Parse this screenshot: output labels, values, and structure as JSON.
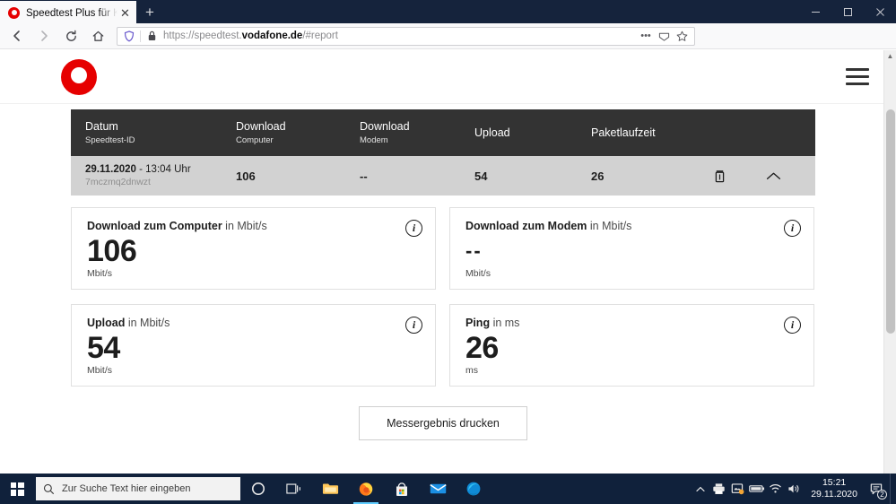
{
  "browser": {
    "tab": {
      "title": "Speedtest Plus für Kabel- und D",
      "close_label": "✕",
      "favicon": "vodafone-favicon"
    },
    "newtab_label": "+",
    "window_controls": {
      "minimize": "minimize-icon",
      "maximize": "restore-icon",
      "close": "close-icon"
    },
    "nav": {
      "back": "back-arrow-icon",
      "forward": "forward-arrow-icon",
      "reload": "reload-icon",
      "home": "home-icon"
    },
    "url": {
      "protocol": "https://speedtest.",
      "domain": "vodafone.de",
      "path": "/#report",
      "shield_icon": "tracking-protection-shield-icon",
      "lock_icon": "padlock-icon",
      "ellipsis": "page-actions-ellipsis-icon",
      "reader": "reader-view-icon",
      "bookmark": "bookmark-star-icon"
    },
    "toolbar": {
      "library": "library-icon",
      "sidebar": "sidebar-icon",
      "account": "account-icon",
      "menu": "hamburger-menu-icon"
    }
  },
  "page": {
    "logo": "vodafone-logo",
    "menu": "page-hamburger-menu",
    "table": {
      "headers": [
        {
          "title": "Datum",
          "sub": "Speedtest-ID"
        },
        {
          "title": "Download",
          "sub": "Computer"
        },
        {
          "title": "Download",
          "sub": "Modem"
        },
        {
          "title": "Upload",
          "sub": ""
        },
        {
          "title": "Paketlaufzeit",
          "sub": ""
        }
      ],
      "row": {
        "date": "29.11.2020",
        "date_sep": " - ",
        "time": "13:04 Uhr",
        "speedtest_id": "7mczmq2dnwzt",
        "download_computer": "106",
        "download_modem": "--",
        "upload": "54",
        "paketlaufzeit": "26",
        "delete_icon": "trash-icon",
        "collapse_icon": "chevron-up-icon"
      }
    },
    "cards": [
      {
        "name_bold": "Download zum Computer",
        "name_rest": " in Mbit/s",
        "value": "106",
        "unit": "Mbit/s",
        "info": "info-icon",
        "is_dash": false
      },
      {
        "name_bold": "Download zum Modem",
        "name_rest": " in Mbit/s",
        "value": "--",
        "unit": "Mbit/s",
        "info": "info-icon",
        "is_dash": true
      },
      {
        "name_bold": "Upload",
        "name_rest": " in Mbit/s",
        "value": "54",
        "unit": "Mbit/s",
        "info": "info-icon",
        "is_dash": false
      },
      {
        "name_bold": "Ping",
        "name_rest": " in ms",
        "value": "26",
        "unit": "ms",
        "info": "info-icon",
        "is_dash": false
      }
    ],
    "print_button": "Messergebnis drucken",
    "scrollbar": {
      "up": "▲",
      "down": "▼"
    }
  },
  "taskbar": {
    "start": "windows-start-icon",
    "search_placeholder": "Zur Suche Text hier eingeben",
    "search_icon": "search-magnifier-icon",
    "items": [
      {
        "name": "cortana-icon"
      },
      {
        "name": "task-view-icon"
      },
      {
        "name": "file-explorer-icon"
      },
      {
        "name": "firefox-icon"
      },
      {
        "name": "microsoft-store-icon"
      },
      {
        "name": "mail-icon"
      },
      {
        "name": "edge-icon"
      }
    ],
    "tray": [
      {
        "name": "tray-chevron-up-icon"
      },
      {
        "name": "printer-icon"
      },
      {
        "name": "onedrive-icon"
      },
      {
        "name": "battery-icon"
      },
      {
        "name": "wifi-icon"
      },
      {
        "name": "volume-icon"
      }
    ],
    "clock_time": "15:21",
    "clock_date": "29.11.2020",
    "notification_icon": "action-center-icon",
    "notification_count": "2"
  },
  "colors": {
    "vodafone_red": "#e60000",
    "table_header": "#333333",
    "row_bg": "#d2d2d2",
    "taskbar": "#10213b",
    "titlebar": "#15233c"
  }
}
